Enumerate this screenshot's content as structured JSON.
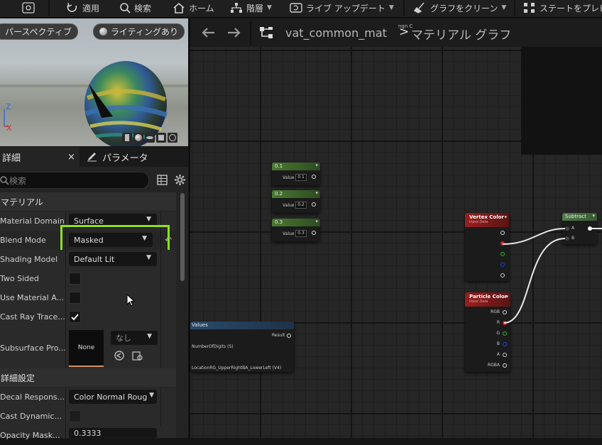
{
  "toolbar": {
    "apply_label": "適用",
    "search_label": "検索",
    "home_label": "ホーム",
    "hierarchy_label": "階層",
    "live_update_label": "ライブ アップデート",
    "clean_graph_label": "グラフをクリーン",
    "state_preview_label": "ステートをプレビ"
  },
  "viewport": {
    "perspective_label": "パースペクティブ",
    "lighting_label": "ライティングあり",
    "axis_z": "Z",
    "axis_x": "X"
  },
  "details": {
    "tab_details": "詳細",
    "tab_parameters": "パラメータ",
    "search_placeholder": "検索",
    "section_material": "マテリアル",
    "section_advanced": "詳細設定",
    "rows": {
      "material_domain": {
        "label": "Material Domain",
        "value": "Surface"
      },
      "blend_mode": {
        "label": "Blend Mode",
        "value": "Masked"
      },
      "shading_model": {
        "label": "Shading Model",
        "value": "Default Lit"
      },
      "two_sided": {
        "label": "Two Sided"
      },
      "use_material_attributes": {
        "label": "Use Material A..."
      },
      "cast_ray_traced": {
        "label": "Cast Ray Trace..."
      },
      "subsurface_profile": {
        "label": "Subsurface Pro...",
        "thumb": "None",
        "combo": "なし"
      },
      "decal_response": {
        "label": "Decal Respons...",
        "value": "Color Normal Roug"
      },
      "cast_dynamic": {
        "label": "Cast Dynamic..."
      },
      "opacity_mask": {
        "label": "Opacity Mask...",
        "value": "0.3333"
      }
    }
  },
  "graph": {
    "breadcrumb_asset": "vat_common_mat",
    "breadcrumb_sep": ">",
    "breadcrumb_graph": "マテリアル グラフ",
    "ghost_tag": "ngn C",
    "nodes": {
      "scalar1": {
        "title": "0.1",
        "pin": "Value",
        "value": "0.1"
      },
      "scalar2": {
        "title": "0.2",
        "pin": "Value",
        "value": "0.2"
      },
      "scalar3": {
        "title": "0.3",
        "pin": "Value",
        "value": "0.3"
      },
      "vertex_color": {
        "title": "Vertex Color",
        "subtitle": "Input Data"
      },
      "particle_color": {
        "title": "Particle Color",
        "subtitle": "Input Data",
        "pins": [
          "RGB",
          "R",
          "G",
          "B",
          "A",
          "RGBA"
        ]
      },
      "subtract": {
        "title": "Subtract",
        "pin_a": "A",
        "pin_b": "B"
      },
      "values": {
        "title": "Values",
        "out": "Result",
        "in1": "NumberOfDigits (S)",
        "in2": "LocationRG_UpperRightBA_LowerLeft (V4)"
      }
    }
  },
  "colors": {
    "highlight": "#8ee01e",
    "accent": "#2f5fb0",
    "vertex_header": "#8b1a1a",
    "scalar_header": "#4a7a32"
  }
}
